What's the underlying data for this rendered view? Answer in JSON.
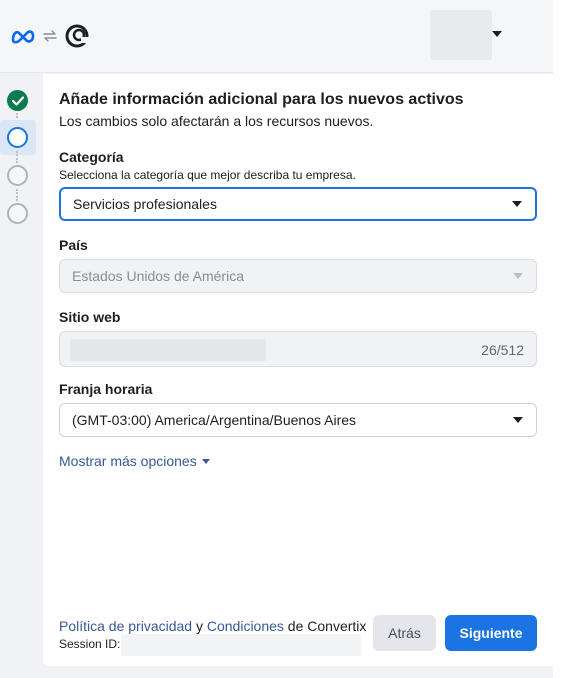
{
  "header": {
    "logos": [
      "meta-logo",
      "sync-icon",
      "business-logo"
    ]
  },
  "stepper": {
    "steps": [
      "done",
      "current",
      "todo",
      "todo"
    ]
  },
  "form": {
    "title": "Añade información adicional para los nuevos activos",
    "subtitle": "Los cambios solo afectarán a los recursos nuevos.",
    "category": {
      "label": "Categoría",
      "help": "Selecciona la categoría que mejor describa tu empresa.",
      "value": "Servicios profesionales"
    },
    "country": {
      "label": "País",
      "value": "Estados Unidos de América"
    },
    "website": {
      "label": "Sitio web",
      "counter": "26/512"
    },
    "timezone": {
      "label": "Franja horaria",
      "value": "(GMT-03:00) America/Argentina/Buenos Aires"
    },
    "more_options": "Mostrar más opciones"
  },
  "footer": {
    "privacy_link": "Política de privacidad",
    "and": " y ",
    "terms_link": "Condiciones",
    "of_company": " de Convertix",
    "session_label": "Session ID:",
    "back_label": "Atrás",
    "next_label": "Siguiente"
  },
  "colors": {
    "primary": "#1b74e4",
    "link": "#385898",
    "success": "#0a7b4f"
  }
}
